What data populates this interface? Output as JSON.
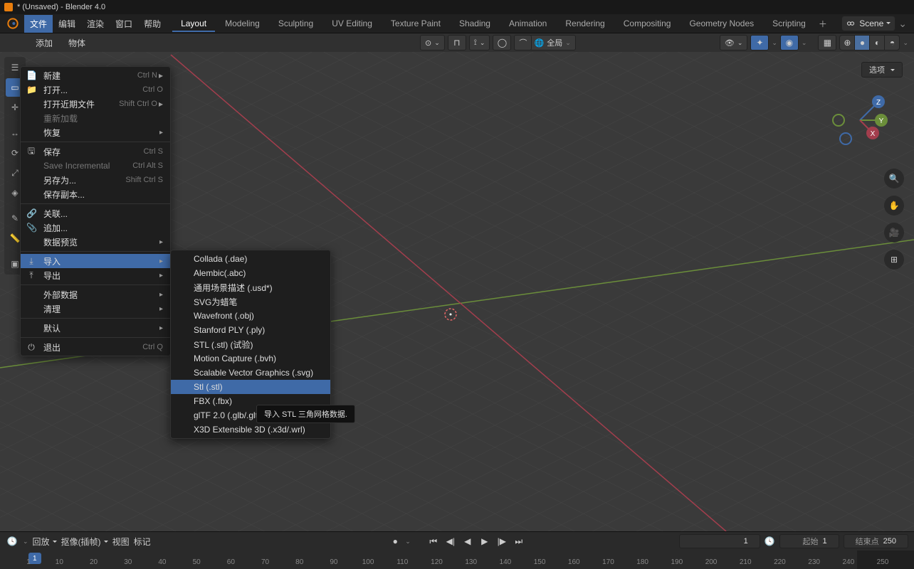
{
  "title": "* (Unsaved) - Blender 4.0",
  "menubar": {
    "items": [
      "文件",
      "编辑",
      "渲染",
      "窗口",
      "帮助"
    ],
    "active": 0,
    "tabs": [
      "Layout",
      "Modeling",
      "Sculpting",
      "UV Editing",
      "Texture Paint",
      "Shading",
      "Animation",
      "Rendering",
      "Compositing",
      "Geometry Nodes",
      "Scripting"
    ],
    "activeTab": 0,
    "scene": "Scene"
  },
  "viewport": {
    "header": [
      "添加",
      "物体"
    ],
    "global": "全局",
    "options": "选项"
  },
  "fileMenu": [
    {
      "label": "新建",
      "icon": "📄",
      "shortcut": "Ctrl N",
      "arrow": true
    },
    {
      "label": "打开...",
      "icon": "📁",
      "shortcut": "Ctrl O"
    },
    {
      "label": "打开近期文件",
      "shortcut": "Shift Ctrl O",
      "arrow": true
    },
    {
      "label": "重新加载",
      "dim": true
    },
    {
      "label": "恢复",
      "arrow": true
    },
    {
      "sep": true
    },
    {
      "label": "保存",
      "icon": "🖫",
      "shortcut": "Ctrl S"
    },
    {
      "label": "Save Incremental",
      "shortcut": "Ctrl Alt S",
      "dim": true
    },
    {
      "label": "另存为...",
      "shortcut": "Shift Ctrl S"
    },
    {
      "label": "保存副本..."
    },
    {
      "sep": true
    },
    {
      "label": "关联...",
      "icon": "🔗"
    },
    {
      "label": "追加...",
      "icon": "📎"
    },
    {
      "label": "数据预览",
      "arrow": true
    },
    {
      "sep": true
    },
    {
      "label": "导入",
      "icon": "⤓",
      "arrow": true,
      "hl": true
    },
    {
      "label": "导出",
      "icon": "⤒",
      "arrow": true
    },
    {
      "sep": true
    },
    {
      "label": "外部数据",
      "arrow": true
    },
    {
      "label": "清理",
      "arrow": true
    },
    {
      "sep": true
    },
    {
      "label": "默认",
      "arrow": true
    },
    {
      "sep": true
    },
    {
      "label": "退出",
      "icon": "⏻",
      "shortcut": "Ctrl Q"
    }
  ],
  "importMenu": [
    {
      "label": "Collada (.dae)"
    },
    {
      "label": "Alembic(.abc)"
    },
    {
      "label": "通用场景描述 (.usd*)"
    },
    {
      "label": "SVG为蜡笔"
    },
    {
      "label": "Wavefront (.obj)"
    },
    {
      "label": "Stanford PLY (.ply)"
    },
    {
      "label": "STL (.stl) (试验)"
    },
    {
      "label": "Motion Capture (.bvh)"
    },
    {
      "label": "Scalable Vector Graphics (.svg)"
    },
    {
      "label": "Stl (.stl)",
      "hl": true
    },
    {
      "label": "FBX (.fbx)"
    },
    {
      "label": "glTF 2.0 (.glb/.gltf)"
    },
    {
      "label": "X3D Extensible 3D (.x3d/.wrl)"
    }
  ],
  "tooltip": "导入 STL 三角网格数据.",
  "timeline": {
    "play": "回放",
    "keying": "抠像(插帧)",
    "view": "视图",
    "mark": "标记",
    "frame": 1,
    "start_lbl": "起始",
    "start": 1,
    "end_lbl": "结束点",
    "end": 250,
    "ticks": [
      1,
      10,
      20,
      30,
      40,
      50,
      60,
      70,
      80,
      90,
      100,
      110,
      120,
      130,
      140,
      150,
      160,
      170,
      180,
      190,
      200,
      210,
      220,
      230,
      240,
      250
    ]
  }
}
